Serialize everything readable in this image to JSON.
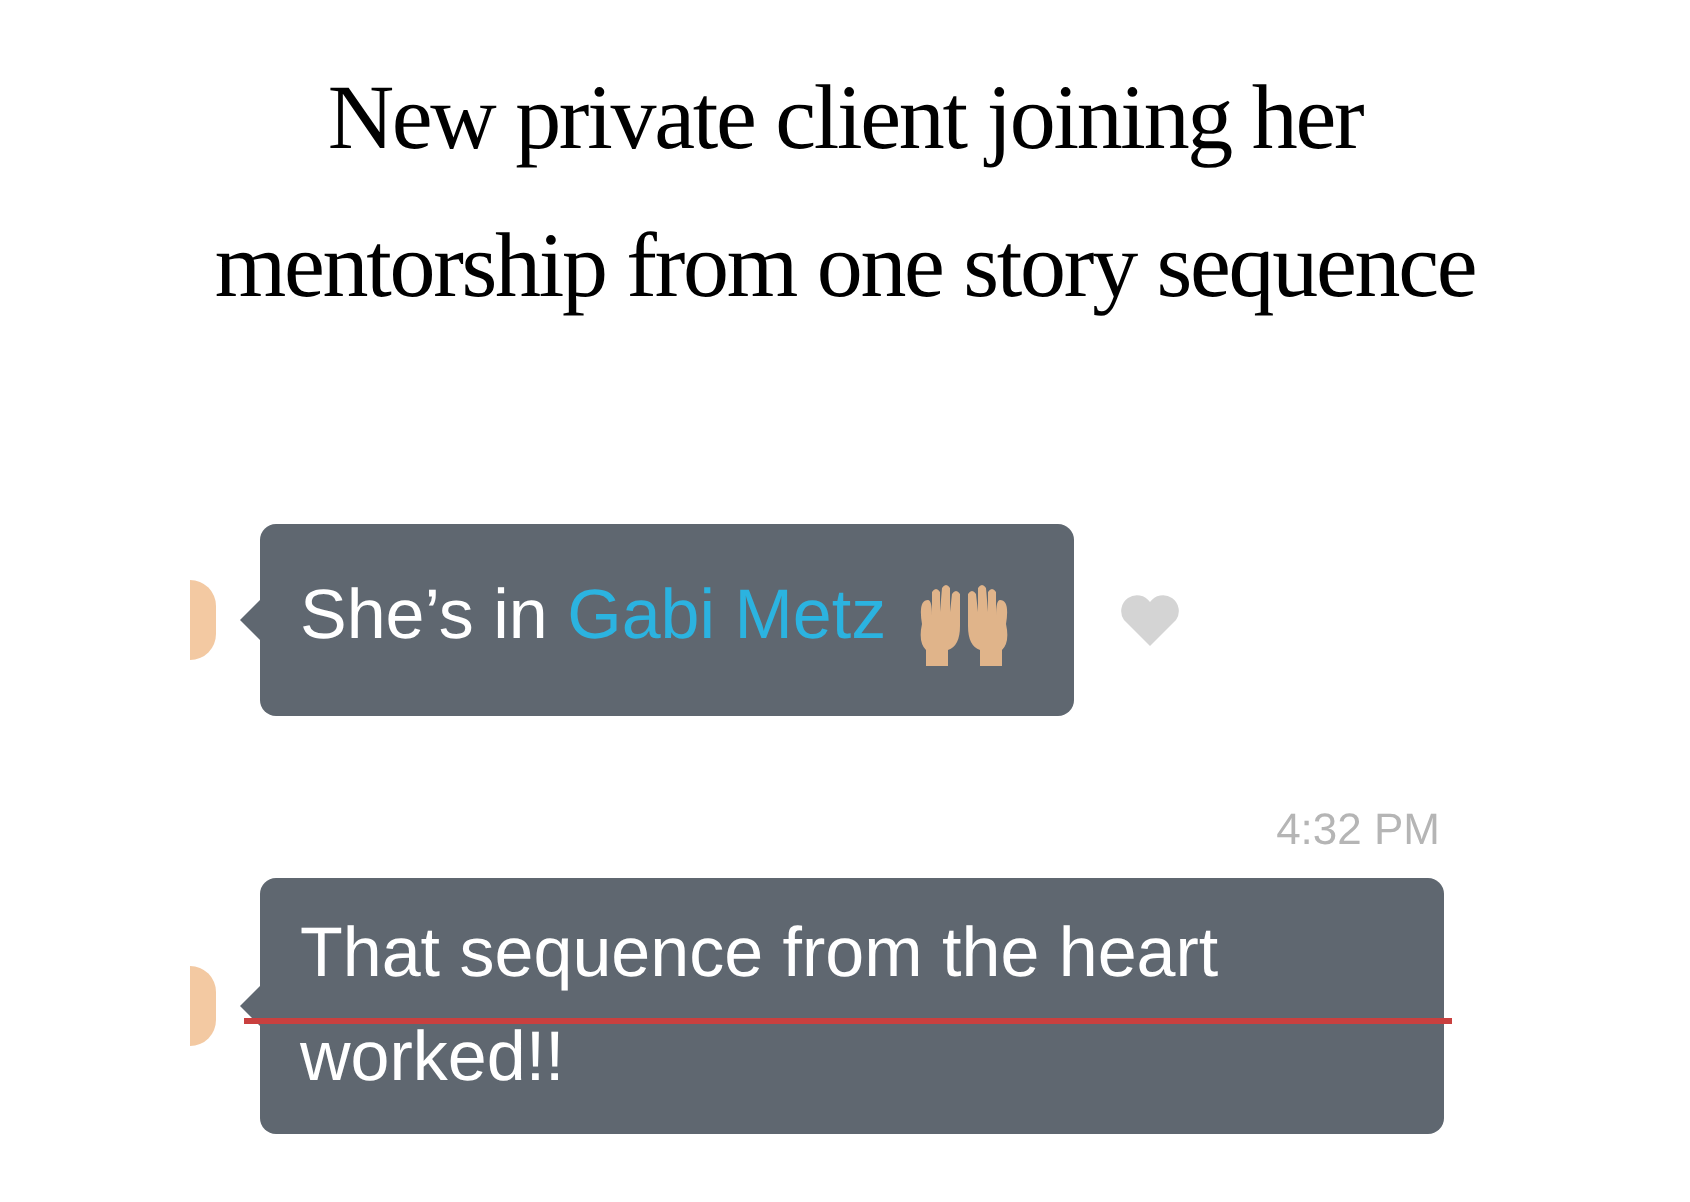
{
  "headline": "New private client joining her mentorship from one story sequence",
  "messages": [
    {
      "text": "She’s in ",
      "mention": "Gabi Metz",
      "highlighted": false
    },
    {
      "text": "That sequence from the heart worked!!",
      "timestamp": "4:32 PM",
      "highlighted": true
    }
  ]
}
